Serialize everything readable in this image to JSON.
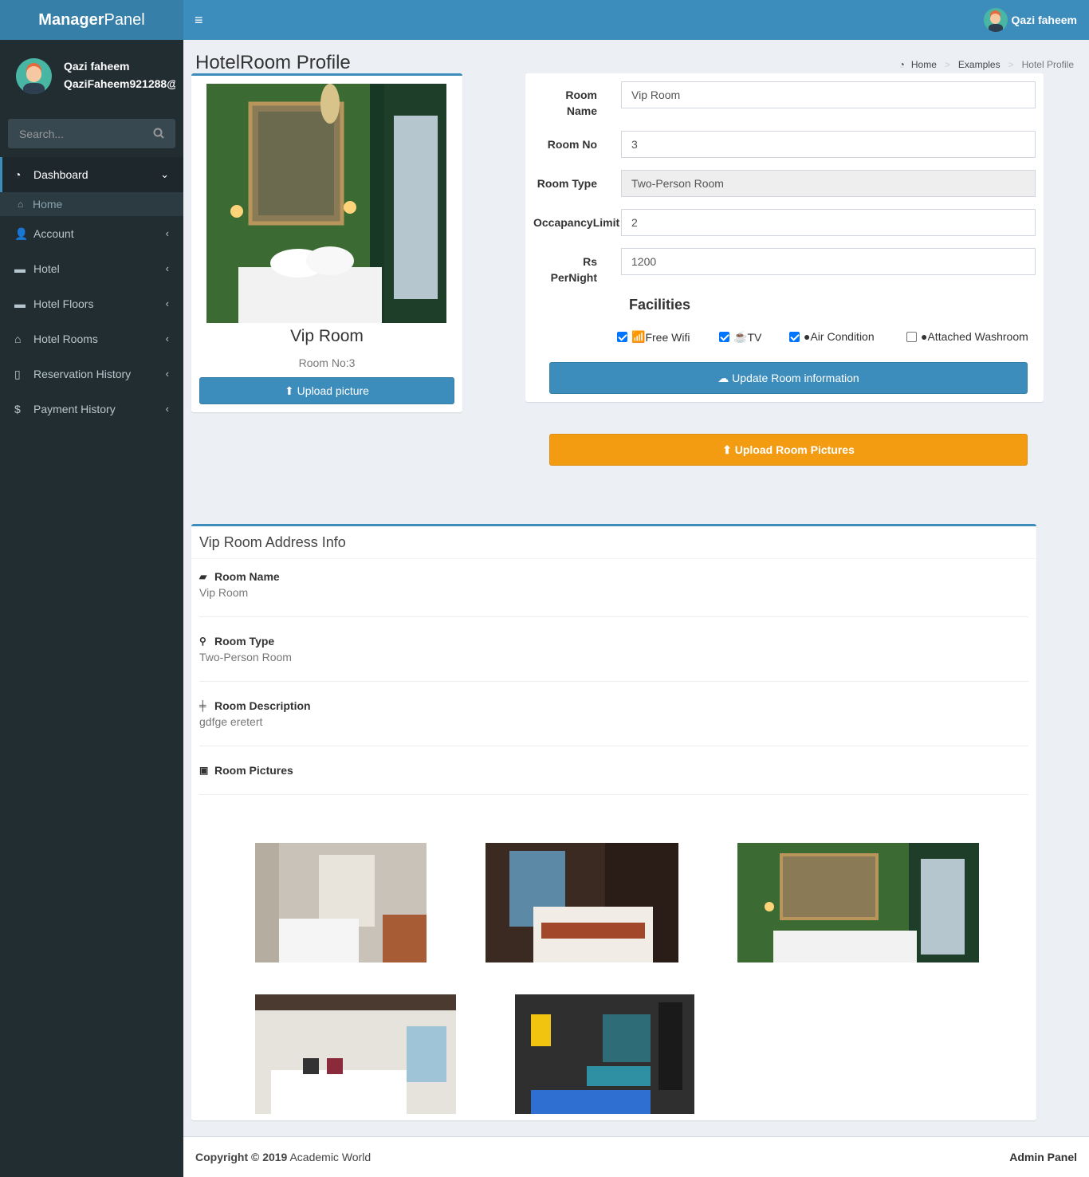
{
  "brand": {
    "bold": "Manager",
    "light": "Panel"
  },
  "top": {
    "username": "Qazi faheem"
  },
  "user": {
    "name": "Qazi faheem",
    "email": "QaziFaheem921288@"
  },
  "search": {
    "placeholder": "Search..."
  },
  "menu": {
    "dashboard": "Dashboard",
    "home": "Home",
    "account": "Account",
    "hotel": "Hotel",
    "floors": "Hotel Floors",
    "rooms": "Hotel Rooms",
    "reservation": "Reservation History",
    "payment": "Payment History"
  },
  "page": {
    "title": "HotelRoom Profile"
  },
  "breadcrumb": {
    "home": "Home",
    "examples": "Examples",
    "current": "Hotel Profile"
  },
  "profile": {
    "room_name": "Vip Room",
    "room_no": "Room No:3",
    "upload_label": "Upload picture"
  },
  "form": {
    "room_name_label": "Room Name",
    "room_name": "Vip Room",
    "room_no_label": "Room No",
    "room_no": "3",
    "room_type_label": "Room Type",
    "room_type": "Two-Person Room",
    "occupancy_label": "OccapancyLimit",
    "occupancy": "2",
    "price_label": "Rs PerNight",
    "price": "1200",
    "facilities_title": "Facilities",
    "facilities": [
      {
        "label": "Free Wifi",
        "checked": true
      },
      {
        "label": "TV",
        "checked": true
      },
      {
        "label": "Air Condition",
        "checked": true
      },
      {
        "label": "Attached Washroom",
        "checked": false
      }
    ],
    "update_label": "Update Room information"
  },
  "upload_pictures_label": "Upload Room Pictures",
  "address": {
    "title": "Vip Room Address Info",
    "room_name_h": "Room Name",
    "room_name": "Vip Room",
    "room_type_h": "Room Type",
    "room_type": "Two-Person Room",
    "desc_h": "Room Description",
    "desc": "gdfge eretert",
    "pictures_h": "Room Pictures"
  },
  "footer": {
    "copyright_bold": "Copyright © 2019",
    "copyright_rest": " Academic World",
    "right": "Admin Panel"
  },
  "colors": {
    "primary": "#3c8dbc",
    "sidebar": "#222d32",
    "warning": "#f39c12"
  }
}
